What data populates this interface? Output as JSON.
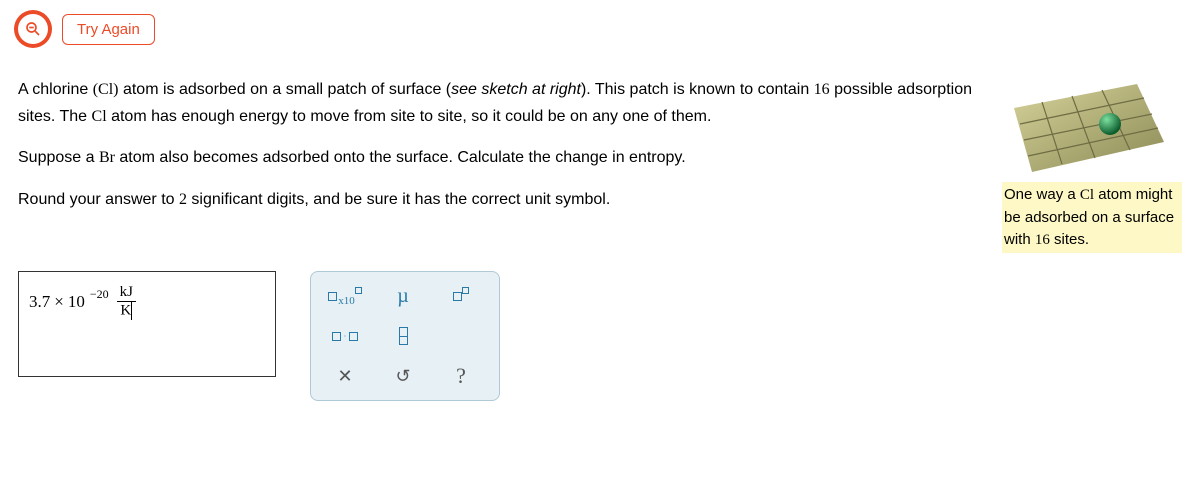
{
  "header": {
    "try_again_label": "Try Again"
  },
  "question": {
    "p1_a": "A chlorine ",
    "p1_sym1": "(Cl)",
    "p1_b": " atom is adsorbed on a small patch of surface (",
    "p1_italic": "see sketch at right",
    "p1_c": "). This patch is known to contain ",
    "p1_num": "16",
    "p1_d": " possible adsorption sites. The ",
    "p1_sym2": "Cl",
    "p1_e": " atom has enough energy to move from site to site, so it could be on any one of them.",
    "p2_a": "Suppose a ",
    "p2_sym": "Br",
    "p2_b": " atom also becomes adsorbed onto the surface. Calculate the change in entropy.",
    "p3_a": "Round your answer to ",
    "p3_num": "2",
    "p3_b": " significant digits, and be sure it has the correct unit symbol."
  },
  "sidebar_caption": {
    "a": "One way a ",
    "sym": "Cl",
    "b": " atom might be adsorbed on a surface with ",
    "num": "16",
    "c": " sites."
  },
  "answer": {
    "coef": "3.7",
    "times": "×",
    "base": "10",
    "exponent": "−20",
    "unit_top": "kJ",
    "unit_bot": "K"
  },
  "palette": {
    "x10": "x10",
    "mu": "µ",
    "dot": "·",
    "clear": "✕",
    "undo": "↺",
    "help": "?"
  }
}
